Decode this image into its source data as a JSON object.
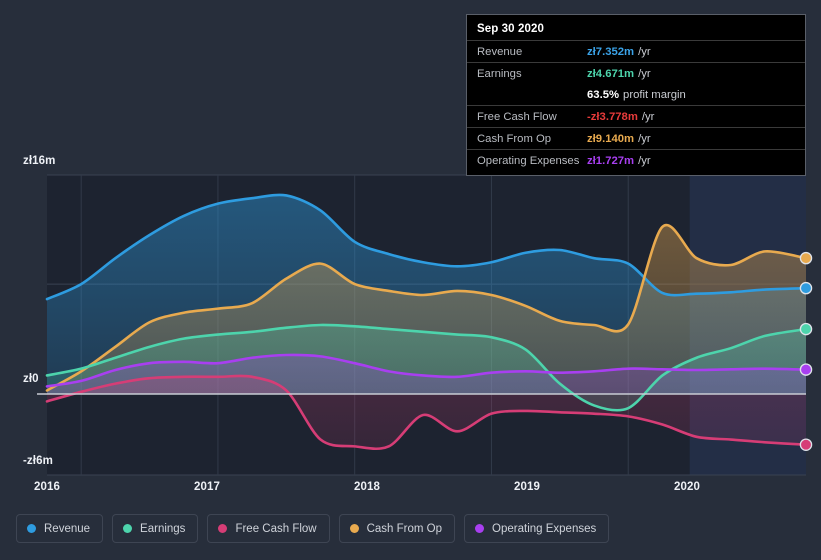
{
  "background_color": "#272e3b",
  "tooltip": {
    "title": "Sep 30 2020",
    "rows": [
      {
        "key": "Revenue",
        "value": "zł7.352m",
        "unit": "/yr",
        "color": "#3ba3e8"
      },
      {
        "key": "Earnings",
        "value": "zł4.671m",
        "unit": "/yr",
        "color": "#4dd4ac"
      },
      {
        "key": "",
        "value": "63.5%",
        "unit": "profit margin",
        "color": "#ffffff",
        "no_rule": true
      },
      {
        "key": "Free Cash Flow",
        "value": "-zł3.778m",
        "unit": "/yr",
        "color": "#e83b3b"
      },
      {
        "key": "Cash From Op",
        "value": "zł9.140m",
        "unit": "/yr",
        "color": "#e8aa4f"
      },
      {
        "key": "Operating Expenses",
        "value": "zł1.727m",
        "unit": "/yr",
        "color": "#a83ff0"
      }
    ]
  },
  "legend": {
    "items": [
      {
        "label": "Revenue",
        "color": "#2e9ce0"
      },
      {
        "label": "Earnings",
        "color": "#4dd4ac"
      },
      {
        "label": "Free Cash Flow",
        "color": "#d63d76"
      },
      {
        "label": "Cash From Op",
        "color": "#e8aa4f"
      },
      {
        "label": "Operating Expenses",
        "color": "#a83ff0"
      }
    ]
  },
  "chart_data": {
    "type": "area",
    "title": "",
    "xlabel": "",
    "ylabel": "",
    "currency": "zł",
    "unit": "m",
    "grid": true,
    "legend_position": "bottom",
    "ylim": [
      -6,
      16
    ],
    "y_ticks": [
      16,
      8,
      0,
      -6
    ],
    "y_tick_labels": [
      "zł16m",
      "",
      "zł0",
      "-zł6m"
    ],
    "x_tick_labels": [
      "2016",
      "2017",
      "2018",
      "2019",
      "2020"
    ],
    "x_tick_values": [
      2016,
      2017,
      2018,
      2019,
      2020
    ],
    "forecast_start": 2020.45,
    "series": [
      {
        "name": "Revenue",
        "color": "#2e9ce0",
        "x": [
          2015.75,
          2016.0,
          2016.25,
          2016.5,
          2016.75,
          2017.0,
          2017.25,
          2017.5,
          2017.75,
          2018.0,
          2018.25,
          2018.5,
          2018.75,
          2019.0,
          2019.25,
          2019.5,
          2019.75,
          2020.0,
          2020.25,
          2020.5,
          2020.75,
          2021.0,
          2021.3
        ],
        "values": [
          6.9,
          8.0,
          9.9,
          11.6,
          13.0,
          13.9,
          14.3,
          14.5,
          13.4,
          11.1,
          10.2,
          9.6,
          9.3,
          9.6,
          10.3,
          10.5,
          9.9,
          9.5,
          7.35,
          7.3,
          7.4,
          7.6,
          7.7
        ]
      },
      {
        "name": "Earnings",
        "color": "#4dd4ac",
        "x": [
          2015.75,
          2016.0,
          2016.25,
          2016.5,
          2016.75,
          2017.0,
          2017.25,
          2017.5,
          2017.75,
          2018.0,
          2018.25,
          2018.5,
          2018.75,
          2019.0,
          2019.25,
          2019.5,
          2019.75,
          2020.0,
          2020.25,
          2020.5,
          2020.75,
          2021.0,
          2021.3
        ],
        "values": [
          1.3,
          1.8,
          2.6,
          3.4,
          4.0,
          4.3,
          4.5,
          4.8,
          5.0,
          4.9,
          4.7,
          4.5,
          4.3,
          4.1,
          3.2,
          0.7,
          -0.9,
          -1.1,
          1.3,
          2.6,
          3.3,
          4.2,
          4.7
        ]
      },
      {
        "name": "Free Cash Flow",
        "color": "#d63d76",
        "x": [
          2015.75,
          2016.0,
          2016.25,
          2016.5,
          2016.75,
          2017.0,
          2017.25,
          2017.5,
          2017.75,
          2018.0,
          2018.25,
          2018.5,
          2018.75,
          2019.0,
          2019.25,
          2019.5,
          2019.75,
          2020.0,
          2020.25,
          2020.5,
          2020.75,
          2021.0,
          2021.3
        ],
        "values": [
          -0.6,
          0.1,
          0.7,
          1.1,
          1.2,
          1.2,
          1.2,
          0.2,
          -3.4,
          -3.9,
          -3.9,
          -1.6,
          -2.8,
          -1.5,
          -1.3,
          -1.4,
          -1.5,
          -1.7,
          -2.3,
          -3.2,
          -3.4,
          -3.6,
          -3.78
        ]
      },
      {
        "name": "Cash From Op",
        "color": "#e8aa4f",
        "x": [
          2015.75,
          2016.0,
          2016.25,
          2016.5,
          2016.75,
          2017.0,
          2017.25,
          2017.5,
          2017.75,
          2018.0,
          2018.25,
          2018.5,
          2018.75,
          2019.0,
          2019.25,
          2019.5,
          2019.75,
          2020.0,
          2020.25,
          2020.5,
          2020.75,
          2021.0,
          2021.3
        ],
        "values": [
          0.2,
          1.6,
          3.4,
          5.2,
          5.9,
          6.2,
          6.6,
          8.4,
          9.5,
          8.0,
          7.5,
          7.2,
          7.5,
          7.2,
          6.4,
          5.3,
          5.0,
          5.05,
          12.2,
          9.9,
          9.4,
          10.4,
          9.9
        ]
      },
      {
        "name": "Operating Expenses",
        "color": "#a83ff0",
        "x": [
          2015.75,
          2016.0,
          2016.25,
          2016.5,
          2016.75,
          2017.0,
          2017.25,
          2017.5,
          2017.75,
          2018.0,
          2018.25,
          2018.5,
          2018.75,
          2019.0,
          2019.25,
          2019.5,
          2019.75,
          2020.0,
          2020.25,
          2020.5,
          2020.75,
          2021.0,
          2021.3
        ],
        "values": [
          0.5,
          0.9,
          1.7,
          2.2,
          2.3,
          2.2,
          2.6,
          2.8,
          2.7,
          2.2,
          1.6,
          1.3,
          1.2,
          1.5,
          1.6,
          1.5,
          1.6,
          1.8,
          1.75,
          1.7,
          1.75,
          1.8,
          1.73
        ]
      }
    ],
    "endpoints": [
      {
        "name": "Cash From Op",
        "value": 9.9,
        "color": "#e8aa4f"
      },
      {
        "name": "Revenue",
        "value": 7.7,
        "color": "#2e9ce0"
      },
      {
        "name": "Earnings",
        "value": 4.7,
        "color": "#4dd4ac"
      },
      {
        "name": "Operating Expenses",
        "value": 1.73,
        "color": "#a83ff0"
      },
      {
        "name": "Free Cash Flow",
        "value": -3.78,
        "color": "#d63d76"
      }
    ]
  }
}
